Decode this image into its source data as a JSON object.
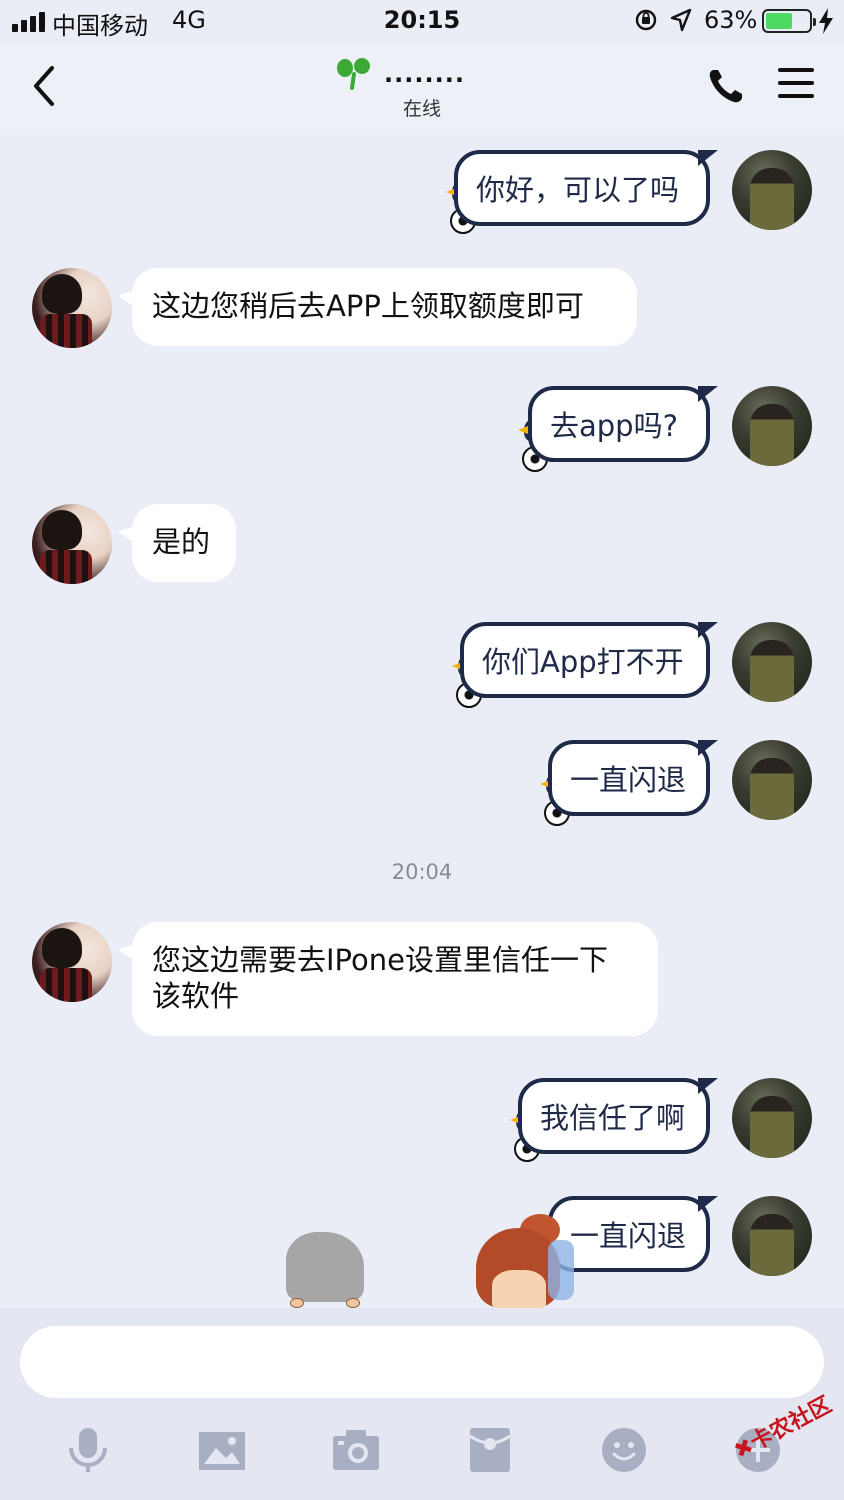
{
  "status_bar": {
    "carrier": "中国移动",
    "network": "4G",
    "time": "20:15",
    "battery_percent": "63%",
    "battery_level": 0.63,
    "battery_color": "#4cd964"
  },
  "header": {
    "contact_name": "........",
    "presence": "在线",
    "icons": [
      "back-chevron-icon",
      "sprout-icon",
      "phone-icon",
      "hamburger-menu-icon"
    ]
  },
  "messages": [
    {
      "side": "out",
      "text": "你好，可以了吗"
    },
    {
      "side": "in",
      "text": "这边您稍后去APP上领取额度即可"
    },
    {
      "side": "out",
      "text": "去app吗?"
    },
    {
      "side": "in",
      "text": "是的"
    },
    {
      "side": "out",
      "text": "你们App打不开"
    },
    {
      "side": "out",
      "text": "一直闪退"
    },
    {
      "side": "in",
      "text": "您这边需要去IPone设置里信任一下该软件"
    },
    {
      "side": "out",
      "text": "我信任了啊"
    },
    {
      "side": "out",
      "text": "一直闪退"
    }
  ],
  "timestamp": "20:04",
  "input": {
    "value": "",
    "placeholder": ""
  },
  "toolbar": {
    "icons": [
      "microphone-icon",
      "image-icon",
      "camera-icon",
      "red-packet-icon",
      "emoji-icon",
      "plus-icon"
    ]
  },
  "watermark": "卡农社区",
  "colors": {
    "background": "#eaedf6",
    "bubble_border": "#1f2a48",
    "toolbar_icon": "#a9afc2"
  }
}
